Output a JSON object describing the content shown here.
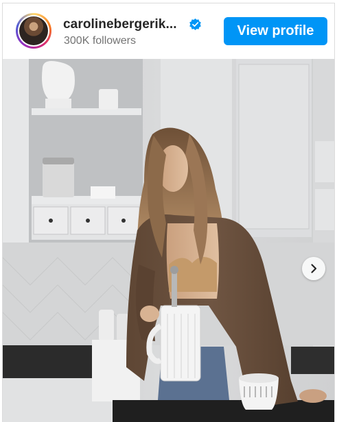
{
  "profile": {
    "username": "carolinebergerik...",
    "followers": "300K followers",
    "verified": true,
    "verified_icon": "verified-badge-icon",
    "view_profile_label": "View profile"
  },
  "post": {
    "image_icon": "photo",
    "next_icon": "chevron-right-icon"
  },
  "colors": {
    "accent": "#0095f6",
    "username": "#262626",
    "secondary_text": "#737373",
    "border": "#dbdbdb"
  }
}
